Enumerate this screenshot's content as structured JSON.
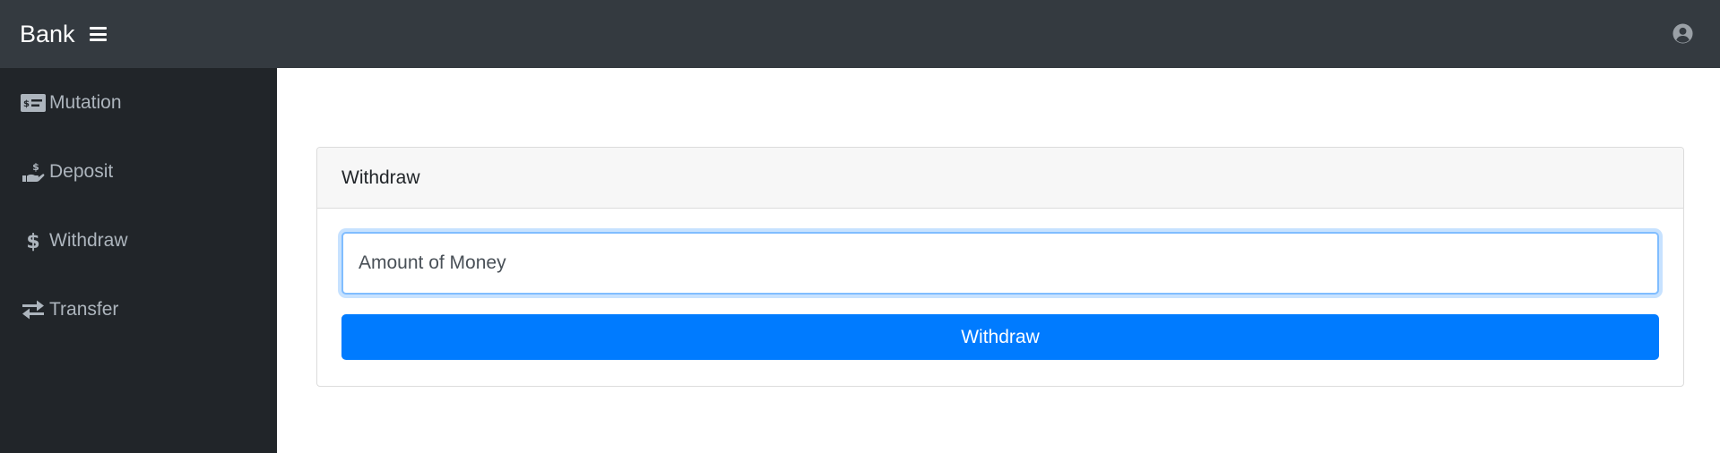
{
  "navbar": {
    "brand": "Bank",
    "menu_icon": "hamburger-menu-icon",
    "user_icon": "user-circle-icon",
    "background": "#343a40"
  },
  "sidebar": {
    "background": "#212529",
    "items": [
      {
        "label": "Mutation",
        "icon": "money-check-icon"
      },
      {
        "label": "Deposit",
        "icon": "hand-holding-usd-icon"
      },
      {
        "label": "Withdraw",
        "icon": "dollar-sign-icon"
      },
      {
        "label": "Transfer",
        "icon": "exchange-arrows-icon"
      }
    ]
  },
  "withdraw_card": {
    "title": "Withdraw",
    "amount_input": {
      "value": "",
      "placeholder": "Amount of Money"
    },
    "submit_label": "Withdraw",
    "accent": "#007bff"
  }
}
